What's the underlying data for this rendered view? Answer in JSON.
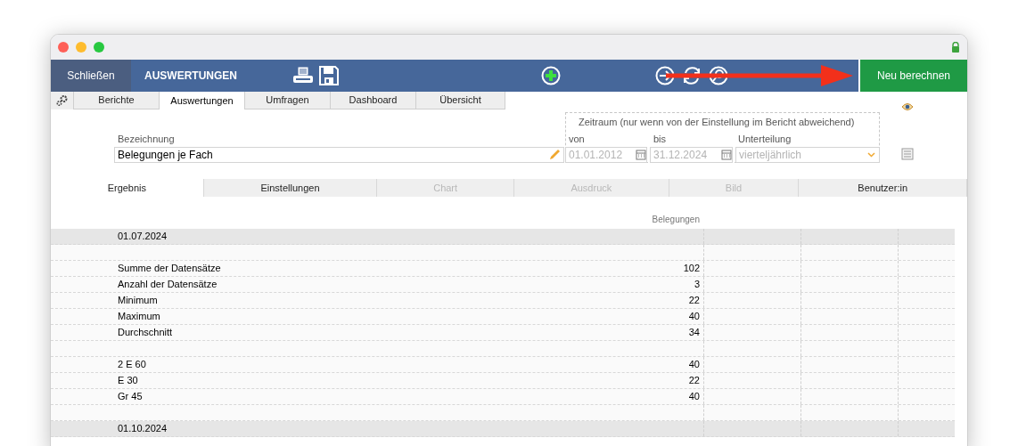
{
  "toolbar": {
    "close_button": "Schließen",
    "title": "AUSWERTUNGEN",
    "recalculate_button": "Neu berechnen"
  },
  "tabs": [
    {
      "label": "Berichte",
      "selected": false
    },
    {
      "label": "Auswertungen",
      "selected": true
    },
    {
      "label": "Umfragen",
      "selected": false
    },
    {
      "label": "Dashboard",
      "selected": false
    },
    {
      "label": "Übersicht",
      "selected": false
    }
  ],
  "form": {
    "name_label": "Bezeichnung",
    "name_value": "Belegungen je Fach",
    "period_title": "Zeitraum (nur wenn von der Einstellung im Bericht abweichend)",
    "from_label": "von",
    "from_value": "01.01.2012",
    "to_label": "bis",
    "to_value": "31.12.2024",
    "division_label": "Unterteilung",
    "division_value": "vierteljährlich"
  },
  "subtabs": [
    {
      "label": "Ergebnis",
      "selected": true,
      "disabled": false
    },
    {
      "label": "Einstellungen",
      "selected": false,
      "disabled": false
    },
    {
      "label": "Chart",
      "selected": false,
      "disabled": true
    },
    {
      "label": "Ausdruck",
      "selected": false,
      "disabled": true
    },
    {
      "label": "Bild",
      "selected": false,
      "disabled": true
    },
    {
      "label": "Benutzer:in",
      "selected": false,
      "disabled": false
    }
  ],
  "table": {
    "columns": [
      "Belegungen"
    ],
    "rows": [
      {
        "kind": "group",
        "label": "01.07.2024"
      },
      {
        "kind": "blank"
      },
      {
        "kind": "row",
        "label": "Summe der Datensätze",
        "value": "102"
      },
      {
        "kind": "row",
        "label": "Anzahl der Datensätze",
        "value": "3"
      },
      {
        "kind": "row",
        "label": "Minimum",
        "value": "22"
      },
      {
        "kind": "row",
        "label": "Maximum",
        "value": "40"
      },
      {
        "kind": "row",
        "label": "Durchschnitt",
        "value": "34"
      },
      {
        "kind": "blank"
      },
      {
        "kind": "row",
        "label": "2 E 60",
        "value": "40"
      },
      {
        "kind": "row",
        "label": "E 30",
        "value": "22"
      },
      {
        "kind": "row",
        "label": "Gr 45",
        "value": "40"
      },
      {
        "kind": "blank"
      },
      {
        "kind": "group",
        "label": "01.10.2024"
      }
    ]
  }
}
